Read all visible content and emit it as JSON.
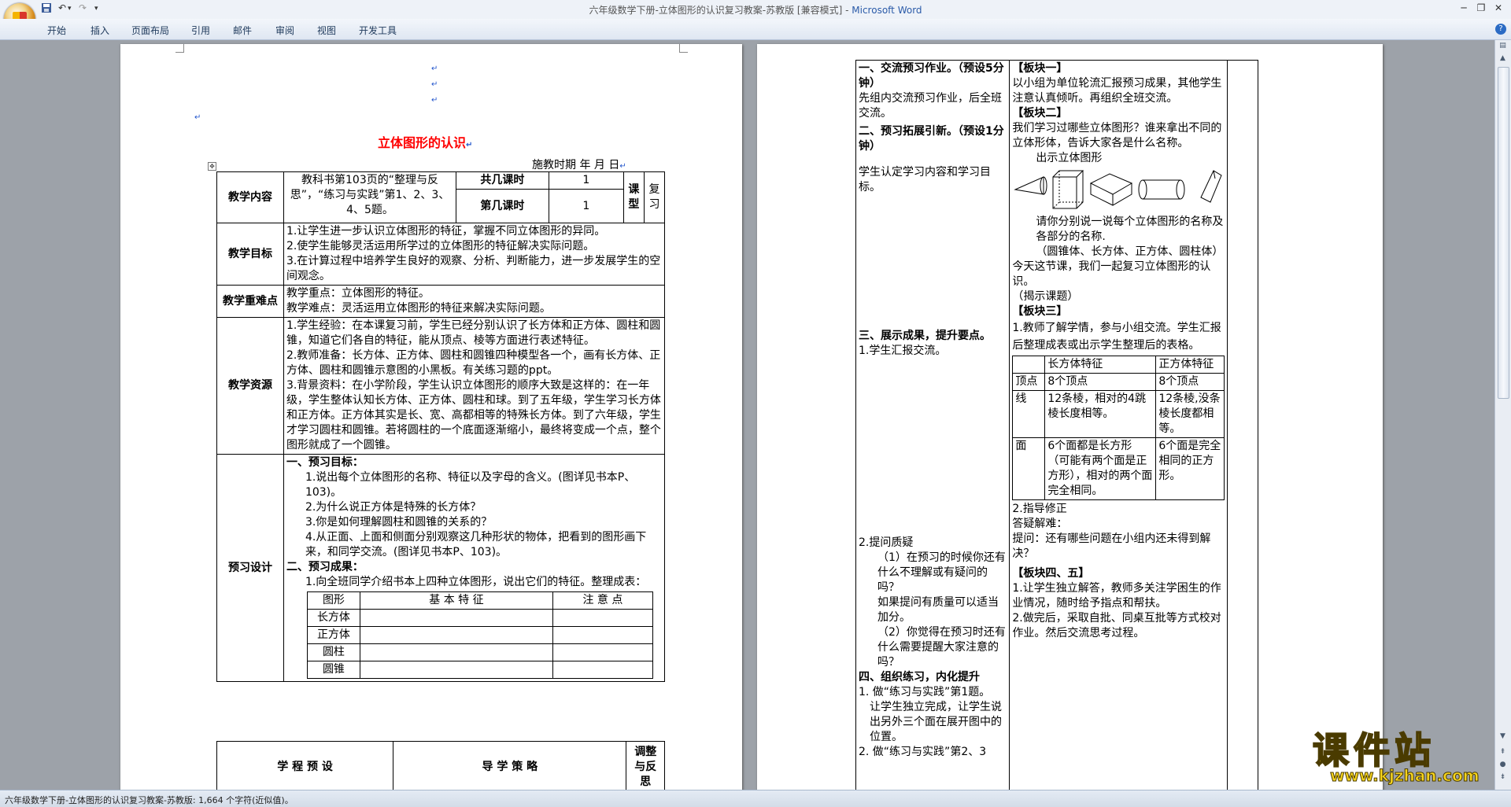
{
  "window": {
    "title": "六年级数学下册-立体图形的认识复习教案-苏教版 [兼容模式]",
    "title_sep": " - ",
    "app_name": "Microsoft Word"
  },
  "qat": {
    "undo_glyph": "↶",
    "redo_glyph": "↷",
    "dropdown_glyph": "▾",
    "more_glyph": "▾"
  },
  "window_controls": {
    "minimize": "─",
    "restore": "❐",
    "close": "✕"
  },
  "ribbon_tabs": [
    "开始",
    "插入",
    "页面布局",
    "引用",
    "邮件",
    "审阅",
    "视图",
    "开发工具"
  ],
  "help": "?",
  "mark": "↵",
  "page1": {
    "title": "立体图形的认识",
    "date_line": "施教时期    年    月    日",
    "content_label": "教学内容",
    "content_text": "教科书第103页的“整理与反思”，“练习与实践”第1、2、3、4、5题。",
    "total_hours_label": "共几课时",
    "total_hours_value": "1",
    "which_hour_label": "第几课时",
    "which_hour_value": "1",
    "type_label": "课型",
    "type_value": "复习",
    "goals_label": "教学目标",
    "goals": [
      "1.让学生进一步认识立体图形的特征，掌握不同立体图形的异同。",
      "2.使学生能够灵活运用所学过的立体图形的特征解决实际问题。",
      "3.在计算过程中培养学生良好的观察、分析、判断能力，进一步发展学生的空间观念。"
    ],
    "keys_label": "教学重难点",
    "keys": [
      "教学重点：立体图形的特征。",
      "教学难点：灵活运用立体图形的特征来解决实际问题。"
    ],
    "resources_label": "教学资源",
    "resources": [
      "1.学生经验：在本课复习前，学生已经分别认识了长方体和正方体、圆柱和圆锥，知道它们各自的特征，能从顶点、棱等方面进行表述特征。",
      "2.教师准备：长方体、正方体、圆柱和圆锥四种模型各一个，画有长方体、正方体、圆柱和圆锥示意图的小黑板。有关练习题的ppt。",
      "3.背景资料：在小学阶段，学生认识立体图形的顺序大致是这样的：在一年级，学生整体认知长方体、正方体、圆柱和球。到了五年级，学生学习长方体和正方体。正方体其实是长、宽、高都相等的特殊长方体。到了六年级，学生才学习圆柱和圆锥。若将圆柱的一个底面逐渐缩小，最终将变成一个点，整个图形就成了一个圆锥。"
    ],
    "preview_label": "预习设计",
    "preview_h1": "一、预习目标：",
    "preview_items": [
      "1.说出每个立体图形的名称、特征以及字母的含义。(图详见书本P、103)。",
      "2.为什么说正方体是特殊的长方体？",
      "3.你是如何理解圆柱和圆锥的关系的？",
      "4.从正面、上面和侧面分别观察这几种形状的物体，把看到的图形画下来，和同学交流。(图详见书本P、103)。"
    ],
    "preview_h2": "二、预习成果：",
    "preview_result": "1.向全班同学介绍书本上四种立体图形，说出它们的特征。整理成表：",
    "shape_table": {
      "headers": [
        "图形",
        "基 本 特 征",
        "注 意 点"
      ],
      "rows": [
        "长方体",
        "正方体",
        "圆柱",
        "圆锥"
      ]
    },
    "footer_cols": [
      "学 程 预 设",
      "导 学 策 略",
      "调整与反思"
    ]
  },
  "page2": {
    "left": [
      {
        "text": "一、交流预习作业。（预设5分钟）",
        "bold": true
      },
      {
        "text": "先组内交流预习作业，后全班交流。",
        "bold": false
      },
      {
        "text": "二、预习拓展引新。（预设1分钟）",
        "bold": true
      },
      {
        "text": "学生认定学习内容和学习目标。",
        "bold": false
      }
    ],
    "left2": [
      {
        "text": "三、展示成果，提升要点。",
        "bold": true
      },
      {
        "text": "1.学生汇报交流。",
        "bold": false
      }
    ],
    "left3": [
      {
        "text": "2.提问质疑",
        "bold": false
      },
      {
        "text": "（1）在预习的时候你还有什么不理解或有疑问的吗？",
        "bold": false
      },
      {
        "text": "如果提问有质量可以适当加分。",
        "bold": false
      },
      {
        "text": "（2）你觉得在预习时还有什么需要提醒大家注意的吗？",
        "bold": false
      },
      {
        "text": "四、组织练习，内化提升",
        "bold": true
      },
      {
        "text": "1. 做“练习与实践”第1题。",
        "bold": false
      },
      {
        "text": "让学生独立完成，让学生说出另外三个面在展开图中的位置。",
        "bold": false
      },
      {
        "text": "2. 做“练习与实践”第2、3",
        "bold": false
      }
    ],
    "block1_title": "【板块一】",
    "block1_text": "以小组为单位轮流汇报预习成果，其他学生注意认真倾听。再组织全班交流。",
    "block2_title": "【板块二】",
    "block2_q": "我们学习过哪些立体图形？谁来拿出不同的立体形体，告诉大家各是什么名称。",
    "block2_show": "出示立体图形",
    "block2_ask": "请你分别说一说每个立体图形的名称及各部分的名称.",
    "block2_names": "（圆锥体、长方体、正方体、圆柱体）",
    "block2_today": "今天这节课，我们一起复习立体图形的认识。",
    "block2_reveal": "（揭示课题）",
    "block3_title": "【板块三】",
    "block3_text": "1.教师了解学情，参与小组交流。学生汇报后整理成表或出示学生整理后的表格。",
    "compare_table": {
      "headers": [
        "",
        "长方体特征",
        "正方体特征"
      ],
      "rows": [
        [
          "顶点",
          "8个顶点",
          "8个顶点"
        ],
        [
          "线",
          "12条棱，相对的4跳棱长度相等。",
          "12条棱,没条棱长度都相等。"
        ],
        [
          "面",
          "6个面都是长方形（可能有两个面是正方形），相对的两个面完全相同。",
          "6个面是完全相同的正方形。"
        ]
      ]
    },
    "guide_title": "2.指导修正",
    "guide_q": "答疑解难：",
    "guide_text": "提问：还有哪些问题在小组内还未得到解决？",
    "block45_title": "【板块四、五】",
    "block45_items": [
      "1.让学生独立解答，教师多关注学困生的作业情况，随时给予指点和帮扶。",
      "2.做完后，采取自批、同桌互批等方式校对作业。然后交流思考过程。"
    ]
  },
  "watermark": {
    "cn": "课件站",
    "url": "www.kjzhan.com"
  },
  "status": {
    "text": "六年级数学下册-立体图形的认识复习教案-苏教版: 1,664 个字符(近似值)。"
  }
}
